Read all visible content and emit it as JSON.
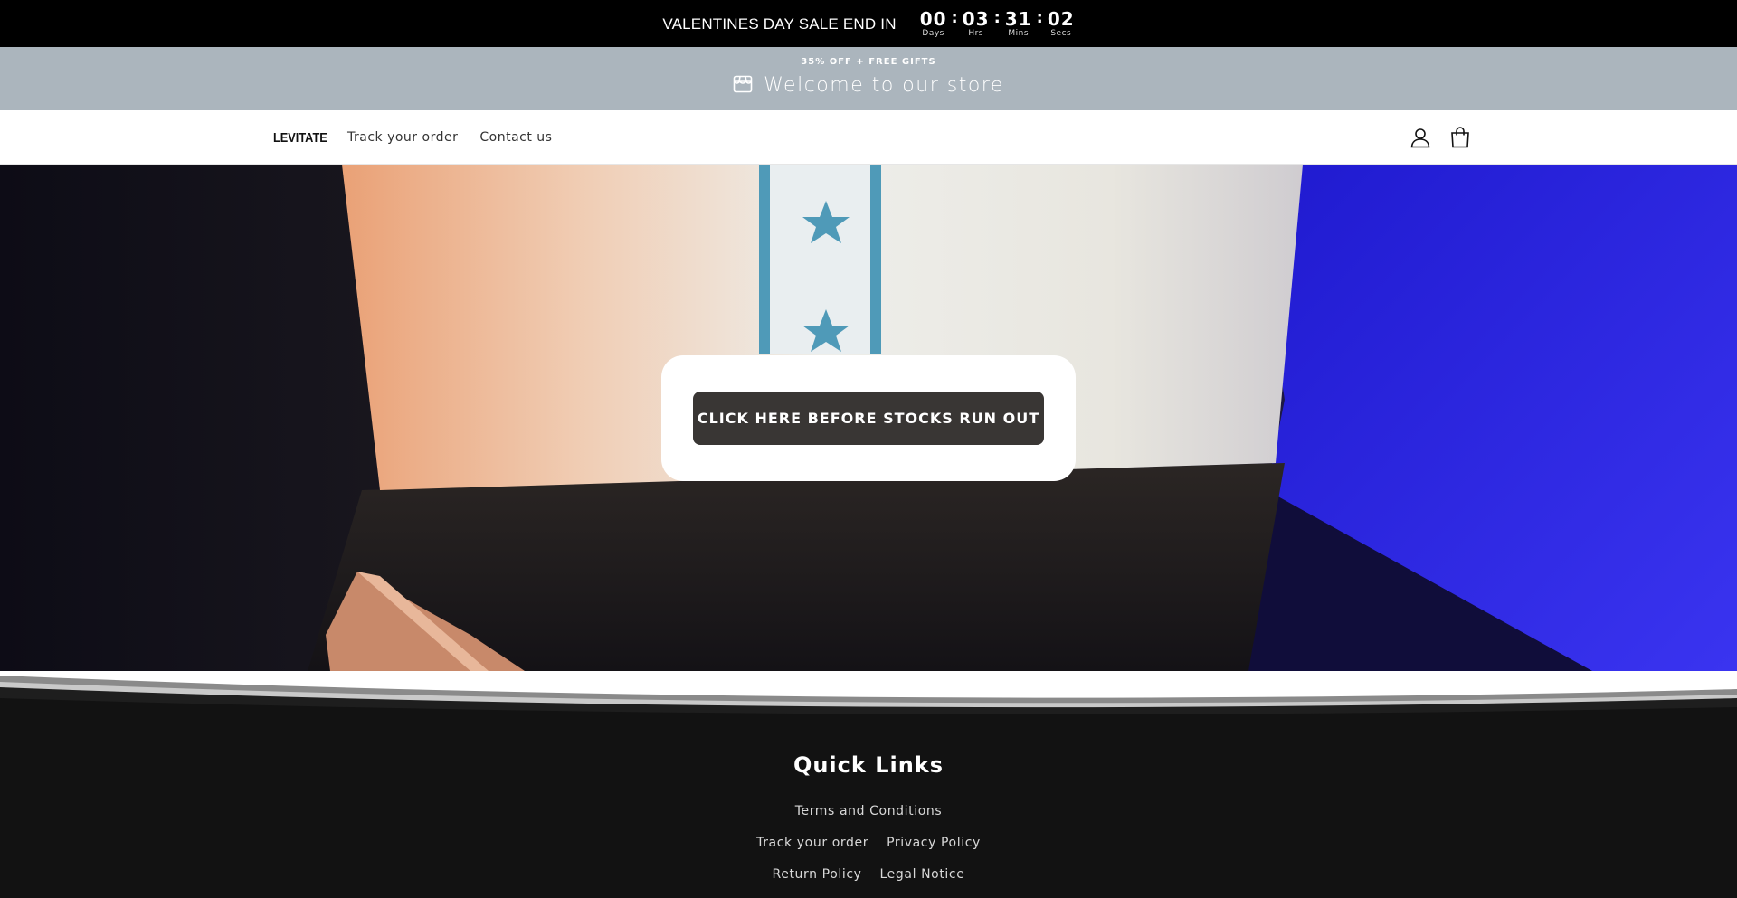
{
  "countdown": {
    "sale_text": "VALENTINES DAY SALE END IN",
    "units": [
      {
        "value": "00",
        "label": "Days"
      },
      {
        "value": "03",
        "label": "Hrs"
      },
      {
        "value": "31",
        "label": "Mins"
      },
      {
        "value": "02",
        "label": "Secs"
      }
    ],
    "separator": ":"
  },
  "announcement": {
    "promo": "35% OFF + FREE GIFTS",
    "welcome": "Welcome to our store",
    "icon": "store-icon"
  },
  "header": {
    "logo": "LEVITATE",
    "nav": [
      "Track your order",
      "Contact us"
    ],
    "icons": [
      "account-icon",
      "cart-icon"
    ]
  },
  "hero": {
    "cta_label": "CLICK HERE BEFORE STOCKS RUN OUT"
  },
  "footer": {
    "heading": "Quick Links",
    "rows": [
      [
        "Terms and Conditions"
      ],
      [
        "Track your order",
        "Privacy Policy"
      ],
      [
        "Return Policy",
        "Legal Notice"
      ]
    ]
  },
  "colors": {
    "countdown_bg": "#000000",
    "announce_bg": "#abb5bd",
    "cta_bg": "#393634",
    "footer_bg": "#121212"
  }
}
